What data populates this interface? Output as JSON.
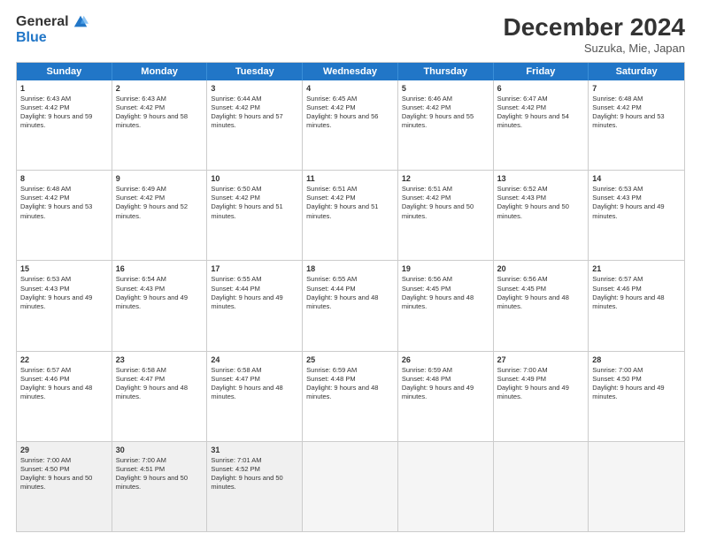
{
  "logo": {
    "general": "General",
    "blue": "Blue"
  },
  "header": {
    "month": "December 2024",
    "location": "Suzuka, Mie, Japan"
  },
  "days": [
    "Sunday",
    "Monday",
    "Tuesday",
    "Wednesday",
    "Thursday",
    "Friday",
    "Saturday"
  ],
  "rows": [
    [
      {
        "day": "1",
        "sunrise": "6:43 AM",
        "sunset": "4:42 PM",
        "daylight": "9 hours and 59 minutes."
      },
      {
        "day": "2",
        "sunrise": "6:43 AM",
        "sunset": "4:42 PM",
        "daylight": "9 hours and 58 minutes."
      },
      {
        "day": "3",
        "sunrise": "6:44 AM",
        "sunset": "4:42 PM",
        "daylight": "9 hours and 57 minutes."
      },
      {
        "day": "4",
        "sunrise": "6:45 AM",
        "sunset": "4:42 PM",
        "daylight": "9 hours and 56 minutes."
      },
      {
        "day": "5",
        "sunrise": "6:46 AM",
        "sunset": "4:42 PM",
        "daylight": "9 hours and 55 minutes."
      },
      {
        "day": "6",
        "sunrise": "6:47 AM",
        "sunset": "4:42 PM",
        "daylight": "9 hours and 54 minutes."
      },
      {
        "day": "7",
        "sunrise": "6:48 AM",
        "sunset": "4:42 PM",
        "daylight": "9 hours and 53 minutes."
      }
    ],
    [
      {
        "day": "8",
        "sunrise": "6:48 AM",
        "sunset": "4:42 PM",
        "daylight": "9 hours and 53 minutes."
      },
      {
        "day": "9",
        "sunrise": "6:49 AM",
        "sunset": "4:42 PM",
        "daylight": "9 hours and 52 minutes."
      },
      {
        "day": "10",
        "sunrise": "6:50 AM",
        "sunset": "4:42 PM",
        "daylight": "9 hours and 51 minutes."
      },
      {
        "day": "11",
        "sunrise": "6:51 AM",
        "sunset": "4:42 PM",
        "daylight": "9 hours and 51 minutes."
      },
      {
        "day": "12",
        "sunrise": "6:51 AM",
        "sunset": "4:42 PM",
        "daylight": "9 hours and 50 minutes."
      },
      {
        "day": "13",
        "sunrise": "6:52 AM",
        "sunset": "4:43 PM",
        "daylight": "9 hours and 50 minutes."
      },
      {
        "day": "14",
        "sunrise": "6:53 AM",
        "sunset": "4:43 PM",
        "daylight": "9 hours and 49 minutes."
      }
    ],
    [
      {
        "day": "15",
        "sunrise": "6:53 AM",
        "sunset": "4:43 PM",
        "daylight": "9 hours and 49 minutes."
      },
      {
        "day": "16",
        "sunrise": "6:54 AM",
        "sunset": "4:43 PM",
        "daylight": "9 hours and 49 minutes."
      },
      {
        "day": "17",
        "sunrise": "6:55 AM",
        "sunset": "4:44 PM",
        "daylight": "9 hours and 49 minutes."
      },
      {
        "day": "18",
        "sunrise": "6:55 AM",
        "sunset": "4:44 PM",
        "daylight": "9 hours and 48 minutes."
      },
      {
        "day": "19",
        "sunrise": "6:56 AM",
        "sunset": "4:45 PM",
        "daylight": "9 hours and 48 minutes."
      },
      {
        "day": "20",
        "sunrise": "6:56 AM",
        "sunset": "4:45 PM",
        "daylight": "9 hours and 48 minutes."
      },
      {
        "day": "21",
        "sunrise": "6:57 AM",
        "sunset": "4:46 PM",
        "daylight": "9 hours and 48 minutes."
      }
    ],
    [
      {
        "day": "22",
        "sunrise": "6:57 AM",
        "sunset": "4:46 PM",
        "daylight": "9 hours and 48 minutes."
      },
      {
        "day": "23",
        "sunrise": "6:58 AM",
        "sunset": "4:47 PM",
        "daylight": "9 hours and 48 minutes."
      },
      {
        "day": "24",
        "sunrise": "6:58 AM",
        "sunset": "4:47 PM",
        "daylight": "9 hours and 48 minutes."
      },
      {
        "day": "25",
        "sunrise": "6:59 AM",
        "sunset": "4:48 PM",
        "daylight": "9 hours and 48 minutes."
      },
      {
        "day": "26",
        "sunrise": "6:59 AM",
        "sunset": "4:48 PM",
        "daylight": "9 hours and 49 minutes."
      },
      {
        "day": "27",
        "sunrise": "7:00 AM",
        "sunset": "4:49 PM",
        "daylight": "9 hours and 49 minutes."
      },
      {
        "day": "28",
        "sunrise": "7:00 AM",
        "sunset": "4:50 PM",
        "daylight": "9 hours and 49 minutes."
      }
    ],
    [
      {
        "day": "29",
        "sunrise": "7:00 AM",
        "sunset": "4:50 PM",
        "daylight": "9 hours and 50 minutes."
      },
      {
        "day": "30",
        "sunrise": "7:00 AM",
        "sunset": "4:51 PM",
        "daylight": "9 hours and 50 minutes."
      },
      {
        "day": "31",
        "sunrise": "7:01 AM",
        "sunset": "4:52 PM",
        "daylight": "9 hours and 50 minutes."
      },
      null,
      null,
      null,
      null
    ]
  ]
}
